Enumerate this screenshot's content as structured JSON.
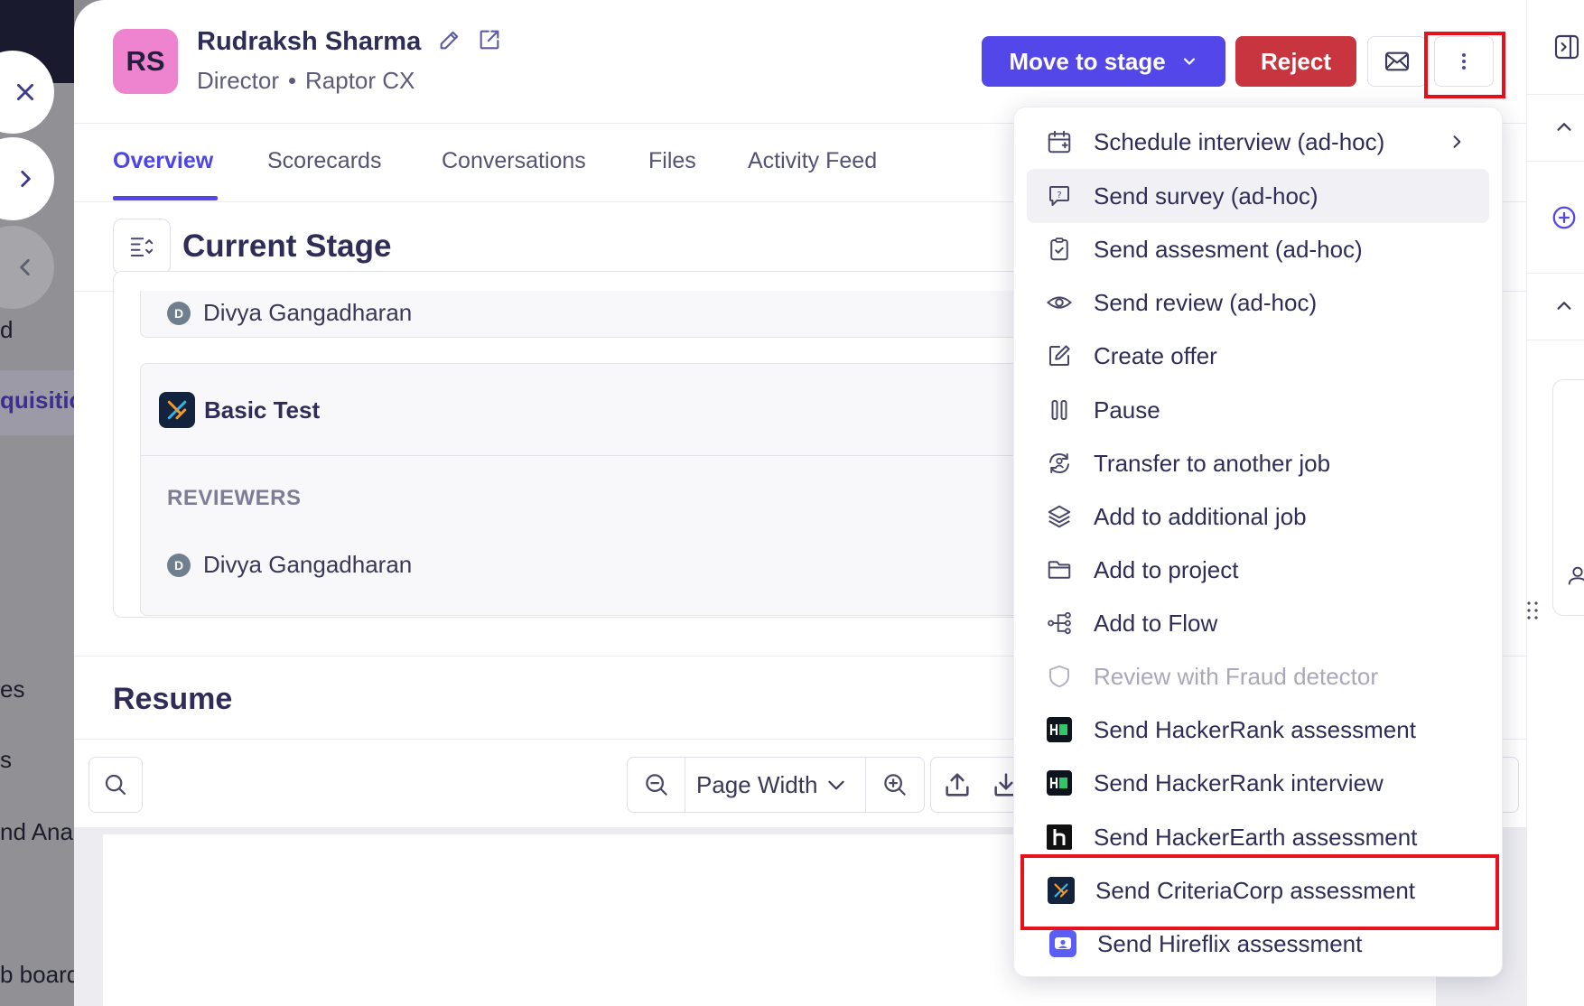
{
  "background_app": {
    "nav_fragments": [
      "d",
      "quisitic",
      "es",
      "s",
      "nd Anal",
      "b board"
    ]
  },
  "candidate": {
    "initials": "RS",
    "name": "Rudraksh Sharma",
    "title": "Director",
    "company": "Raptor CX"
  },
  "actions": {
    "move_to_stage": "Move to stage",
    "reject": "Reject"
  },
  "tabs": [
    {
      "label": "Overview",
      "active": true
    },
    {
      "label": "Scorecards",
      "active": false
    },
    {
      "label": "Conversations",
      "active": false
    },
    {
      "label": "Files",
      "active": false
    },
    {
      "label": "Activity Feed",
      "active": false
    }
  ],
  "current_stage": {
    "title": "Current Stage",
    "top_reviewer": {
      "initial": "D",
      "name": "Divya Gangadharan"
    },
    "test": {
      "name": "Basic Test",
      "reviewers_label": "REVIEWERS",
      "reviewer": {
        "initial": "D",
        "name": "Divya Gangadharan"
      }
    }
  },
  "resume": {
    "title": "Resume",
    "zoom_mode": "Page Width"
  },
  "menu": {
    "items": [
      {
        "label": "Schedule interview (ad-hoc)",
        "icon": "calendar-plus-icon",
        "submenu": true
      },
      {
        "label": "Send survey (ad-hoc)",
        "icon": "survey-icon",
        "hovered": true
      },
      {
        "label": "Send assesment (ad-hoc)",
        "icon": "clipboard-check-icon"
      },
      {
        "label": "Send review (ad-hoc)",
        "icon": "eye-icon"
      },
      {
        "label": "Create offer",
        "icon": "edit-icon"
      },
      {
        "label": "Pause",
        "icon": "pause-icon"
      },
      {
        "label": "Transfer to another job",
        "icon": "transfer-icon"
      },
      {
        "label": "Add to additional job",
        "icon": "layers-icon"
      },
      {
        "label": "Add to project",
        "icon": "folder-icon"
      },
      {
        "label": "Add to Flow",
        "icon": "flow-icon"
      },
      {
        "label": "Review with Fraud detector",
        "icon": "shield-icon",
        "disabled": true
      },
      {
        "label": "Send HackerRank assessment",
        "icon": "hackerrank-logo-icon"
      },
      {
        "label": "Send HackerRank interview",
        "icon": "hackerrank-logo-icon"
      },
      {
        "label": "Send HackerEarth assessment",
        "icon": "hackerearth-logo-icon"
      },
      {
        "label": "Send CriteriaCorp assessment",
        "icon": "criteriacorp-logo-icon",
        "highlighted": true
      },
      {
        "label": "Send Hireflix assessment",
        "icon": "hireflix-logo-icon"
      }
    ]
  },
  "colors": {
    "primary": "#5447ea",
    "danger": "#c8353f",
    "avatar": "#ee83cf",
    "highlight": "#e8101a"
  }
}
